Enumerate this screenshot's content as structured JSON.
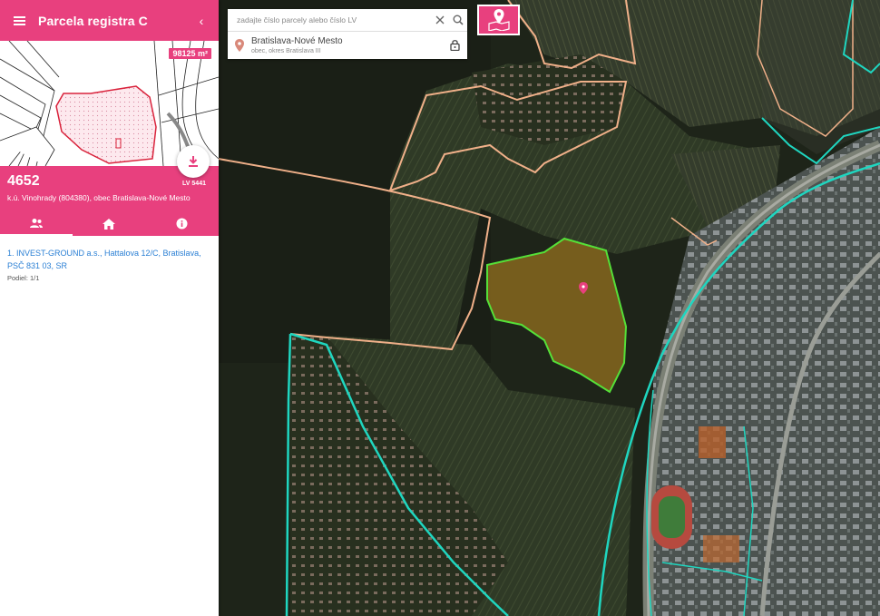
{
  "sidebar": {
    "title": "Parcela registra C",
    "area_badge": "98125 m²",
    "parcel_number": "4652",
    "location": "k.ú. Vinohrady (804380), obec Bratislava-Nové Mesto",
    "lv": "LV 5441",
    "tabs": [
      {
        "icon": "people-icon",
        "active": true
      },
      {
        "icon": "home-icon",
        "active": false
      },
      {
        "icon": "info-icon",
        "active": false
      }
    ],
    "owner": {
      "line1": "1. INVEST-GROUND a.s., Hattalova 12/C, Bratislava,",
      "line2": "PSČ 831 03, SR",
      "share": "Podiel: 1/1"
    }
  },
  "search": {
    "placeholder": "zadajte číslo parcely alebo číslo LV",
    "result_title": "Bratislava-Nové Mesto",
    "result_subtitle": "obec, okres Bratislava III"
  },
  "colors": {
    "accent": "#e8407e",
    "parcel_outline": "#55e038",
    "boundary_cyan": "#1fd6c0",
    "boundary_orange": "#f0b089"
  }
}
